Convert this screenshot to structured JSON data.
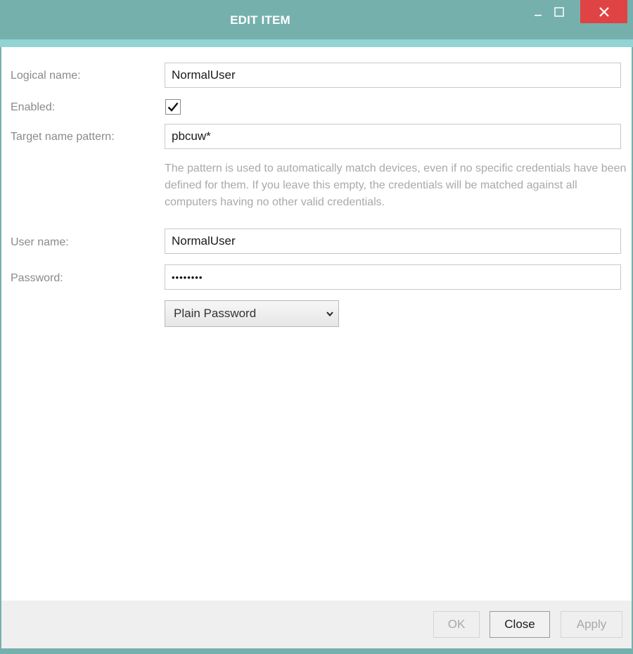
{
  "window": {
    "title": "EDIT ITEM",
    "colors": {
      "titlebar": "#76b0ad",
      "accent": "#92d3d4",
      "close": "#e04343"
    }
  },
  "form": {
    "logical_name": {
      "label": "Logical name:",
      "value": "NormalUser"
    },
    "enabled": {
      "label": "Enabled:",
      "checked": true
    },
    "target_pattern": {
      "label": "Target name pattern:",
      "value": "pbcuw*",
      "hint": "The pattern is used to automatically match devices, even if no specific credentials have been defined for them. If you leave this empty, the credentials will be matched against all computers having no other valid credentials."
    },
    "user_name": {
      "label": "User name:",
      "value": "NormalUser"
    },
    "password": {
      "label": "Password:",
      "value": "••••••••"
    },
    "password_type": {
      "selected": "Plain Password"
    }
  },
  "footer": {
    "ok_label": "OK",
    "close_label": "Close",
    "apply_label": "Apply"
  }
}
